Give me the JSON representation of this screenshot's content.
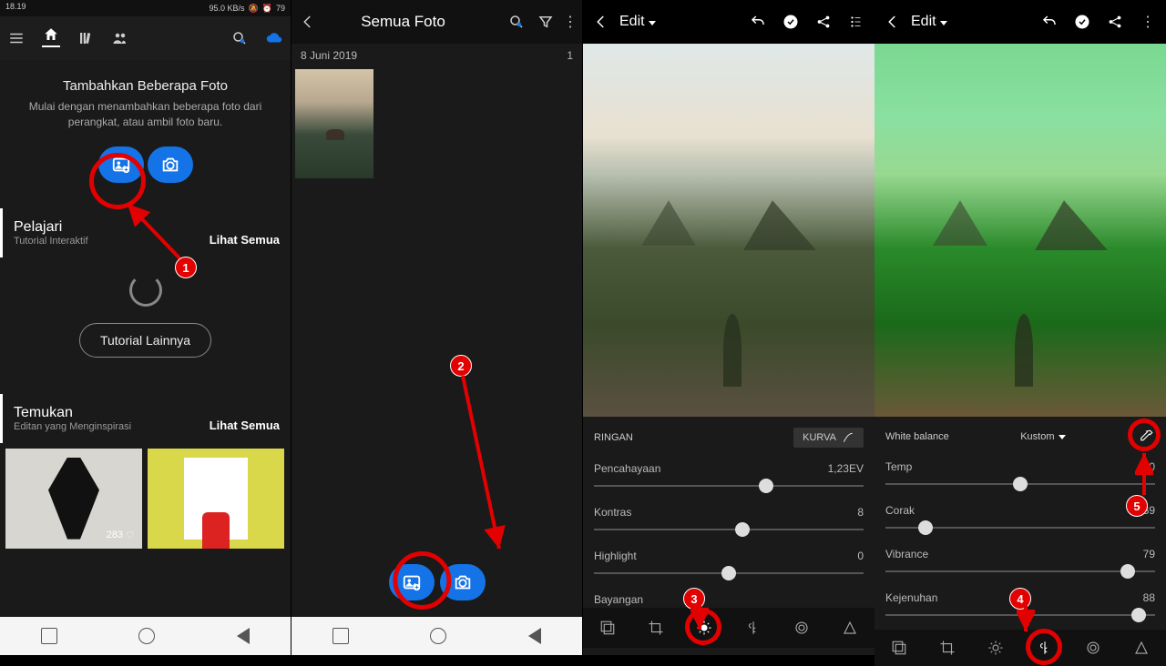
{
  "status": {
    "time": "18.19",
    "net": "95.0 KB/s",
    "battery": "79"
  },
  "panel1": {
    "add_title": "Tambahkan Beberapa Foto",
    "add_sub": "Mulai dengan menambahkan beberapa foto dari perangkat, atau ambil foto baru.",
    "learn": {
      "heading": "Pelajari",
      "sub": "Tutorial Interaktif",
      "more": "Lihat Semua",
      "more_btn": "Tutorial Lainnya"
    },
    "discover": {
      "heading": "Temukan",
      "sub": "Editan yang Menginspirasi",
      "more": "Lihat Semua",
      "likes": "283"
    }
  },
  "panel2": {
    "title": "Semua Foto",
    "date": "8 Juni 2019",
    "count": "1"
  },
  "panel3": {
    "title": "Edit",
    "section": "RINGAN",
    "kurva": "KURVA",
    "sliders": {
      "exposure_label": "Pencahayaan",
      "exposure_val": "1,23EV",
      "contrast_label": "Kontras",
      "contrast_val": "8",
      "highlight_label": "Highlight",
      "highlight_val": "0",
      "shadow_label": "Bayangan"
    }
  },
  "panel4": {
    "title": "Edit",
    "wb_label": "White balance",
    "wb_value": "Kustom",
    "sliders": {
      "temp_label": "Temp",
      "temp_val": "0",
      "tint_label": "Corak",
      "tint_val": "-69",
      "vibrance_label": "Vibrance",
      "vibrance_val": "79",
      "saturation_label": "Kejenuhan",
      "saturation_val": "88"
    }
  },
  "annotations": {
    "n1": "1",
    "n2": "2",
    "n3": "3",
    "n4": "4",
    "n5": "5"
  }
}
